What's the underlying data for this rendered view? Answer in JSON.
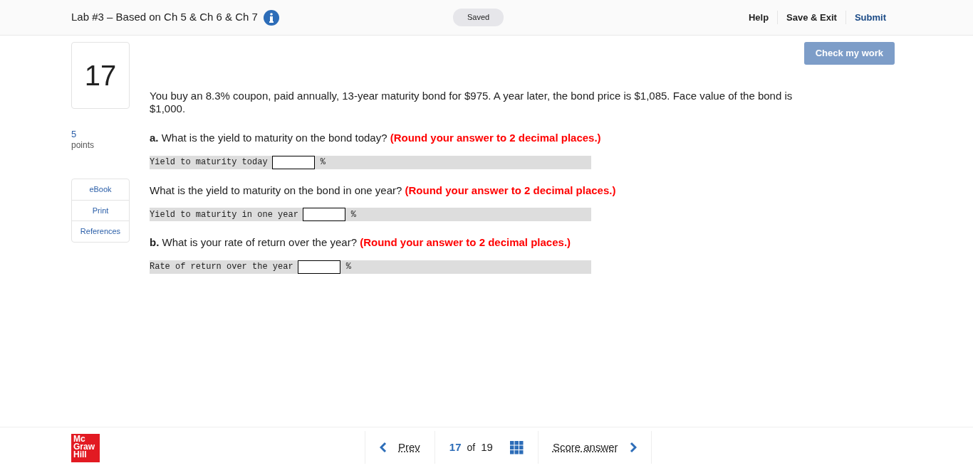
{
  "header": {
    "title": "Lab #3 – Based on Ch 5 & Ch 6 & Ch 7",
    "status": "Saved",
    "links": [
      {
        "label": "Help",
        "kind": "plain"
      },
      {
        "label": "Save & Exit",
        "kind": "plain"
      },
      {
        "label": "Submit",
        "kind": "primary"
      }
    ]
  },
  "check_button": {
    "label": "Check my work",
    "disabled": true
  },
  "question_number": "17",
  "points": {
    "value": "5",
    "label": "points"
  },
  "side_links": [
    "eBook",
    "Print",
    "References"
  ],
  "intro": "You buy an 8.3% coupon, paid annually, 13-year maturity bond for $975. A year later, the bond price is $1,085. Face value of the bond is $1,000.",
  "parts": [
    {
      "kind": "question",
      "text": "**a.** What is the yield to maturity on the bond today?",
      "hint": "(Round your answer to 2 decimal places.)"
    },
    {
      "kind": "answer",
      "label": "Yield to maturity today",
      "unit": "%"
    },
    {
      "kind": "question",
      "text": "What is the yield to maturity on the bond in one year?",
      "hint": "(Round your answer to 2 decimal places.)"
    },
    {
      "kind": "answer",
      "label": "Yield to maturity in one year",
      "unit": "%"
    },
    {
      "kind": "question",
      "text": "**b.** What is your rate of return over the year?",
      "hint": "(Round your answer to 2 decimal places.)"
    },
    {
      "kind": "answer",
      "label": "Rate of return over the year",
      "unit": "%"
    }
  ],
  "footer": {
    "logo": [
      "Mc",
      "Graw",
      "Hill"
    ],
    "prev": "Prev",
    "current": "17",
    "of": "of",
    "total": "19",
    "next": "Score answer"
  }
}
